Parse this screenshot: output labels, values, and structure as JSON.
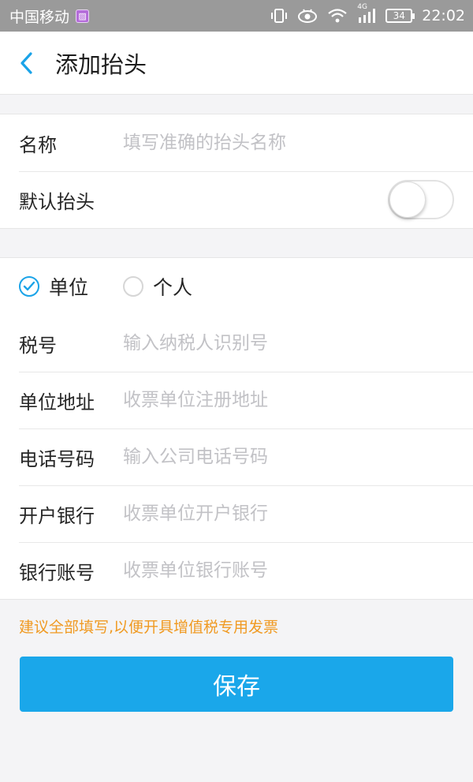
{
  "status_bar": {
    "carrier": "中国移动",
    "network": "4G",
    "battery": "34",
    "time": "22:02"
  },
  "nav": {
    "title": "添加抬头"
  },
  "form_top": {
    "name_label": "名称",
    "name_placeholder": "填写准确的抬头名称",
    "default_label": "默认抬头",
    "default_on": false
  },
  "type_selector": {
    "options": [
      {
        "label": "单位",
        "checked": true
      },
      {
        "label": "个人",
        "checked": false
      }
    ]
  },
  "fields": [
    {
      "label": "税号",
      "placeholder": "输入纳税人识别号"
    },
    {
      "label": "单位地址",
      "placeholder": "收票单位注册地址"
    },
    {
      "label": "电话号码",
      "placeholder": "输入公司电话号码"
    },
    {
      "label": "开户银行",
      "placeholder": "收票单位开户银行"
    },
    {
      "label": "银行账号",
      "placeholder": "收票单位银行账号"
    }
  ],
  "hint": "建议全部填写,以便开具增值税专用发票",
  "save_label": "保存",
  "colors": {
    "accent": "#1aa7ea",
    "hint": "#f09a22",
    "status_bar": "#9a9a9a"
  }
}
